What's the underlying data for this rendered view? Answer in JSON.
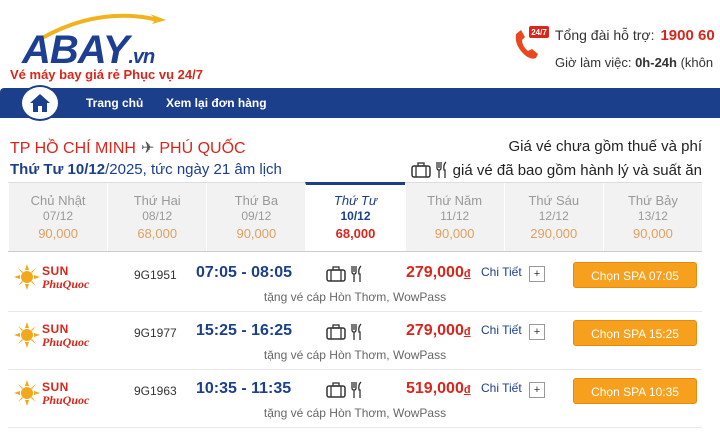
{
  "brand": {
    "logo_main": "ABAY",
    "logo_suffix": ".vn",
    "tagline": "Vé máy bay giá rẻ Phục vụ 24/7"
  },
  "support": {
    "badge": "24/7",
    "hotline_label": "Tổng đài hỗ trợ:",
    "hotline_number": "1900 60",
    "hours_label": "Giờ làm việc:",
    "hours_value": "0h-24h",
    "hours_suffix": "(khôn"
  },
  "nav": {
    "home_icon": "home-icon",
    "items": [
      {
        "label": "Trang chủ"
      },
      {
        "label": "Xem lại đơn hàng"
      }
    ]
  },
  "route": {
    "from": "TP HỒ CHÍ MINH",
    "to": "PHÚ QUỐC",
    "date_bold": "Thứ Tư 10/12",
    "date_rest": "/2025, tức ngày 21 âm lịch",
    "price_note": "Giá vé chưa gồm thuế và phí",
    "luggage_note": "giá vé đã bao gồm hành lý và suất ăn"
  },
  "days": [
    {
      "name": "Chủ Nhật",
      "date": "07/12",
      "price": "90,000",
      "active": false
    },
    {
      "name": "Thứ Hai",
      "date": "08/12",
      "price": "68,000",
      "active": false
    },
    {
      "name": "Thứ Ba",
      "date": "09/12",
      "price": "90,000",
      "active": false
    },
    {
      "name": "Thứ Tư",
      "date": "10/12",
      "price": "68,000",
      "active": true
    },
    {
      "name": "Thứ Năm",
      "date": "11/12",
      "price": "90,000",
      "active": false
    },
    {
      "name": "Thứ Sáu",
      "date": "12/12",
      "price": "290,000",
      "active": false
    },
    {
      "name": "Thứ Bảy",
      "date": "13/12",
      "price": "90,000",
      "active": false
    }
  ],
  "flights": [
    {
      "airline_top": "SUN",
      "airline_bottom": "PhuQuoc",
      "code": "9G1951",
      "time": "07:05 - 08:05",
      "price": "279,000",
      "currency": "đ",
      "detail": "Chi Tiết",
      "plus": "+",
      "button": "Chọn SPA 07:05",
      "note": "tặng vé cáp Hòn Thơm, WowPass"
    },
    {
      "airline_top": "SUN",
      "airline_bottom": "PhuQuoc",
      "code": "9G1977",
      "time": "15:25 - 16:25",
      "price": "279,000",
      "currency": "đ",
      "detail": "Chi Tiết",
      "plus": "+",
      "button": "Chọn SPA 15:25",
      "note": "tặng vé cáp Hòn Thơm, WowPass"
    },
    {
      "airline_top": "SUN",
      "airline_bottom": "PhuQuoc",
      "code": "9G1963",
      "time": "10:35 - 11:35",
      "price": "519,000",
      "currency": "đ",
      "detail": "Chi Tiết",
      "plus": "+",
      "button": "Chọn SPA 10:35",
      "note": "tặng vé cáp Hòn Thơm, WowPass"
    }
  ],
  "colors": {
    "brand_blue": "#1c3f8c",
    "brand_red": "#d9261c",
    "button_orange": "#f7a01e"
  }
}
